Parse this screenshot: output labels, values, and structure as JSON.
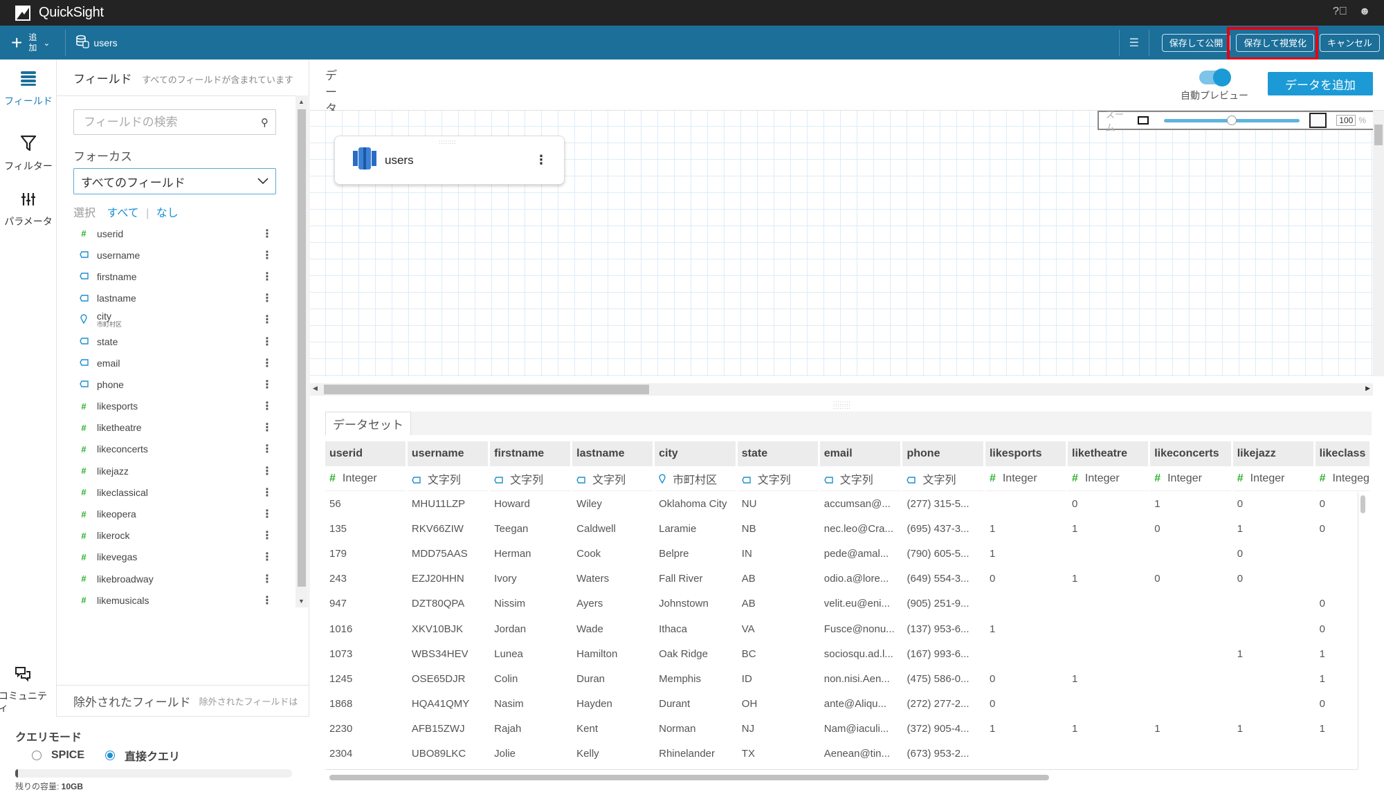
{
  "app": {
    "title": "QuickSight"
  },
  "topbar": {
    "help_icon": "help-icon",
    "user_icon": "user-icon"
  },
  "toolbar": {
    "add_label": "追加",
    "dataset_name": "users",
    "save_publish": "保存して公開",
    "save_visualize": "保存して視覚化",
    "cancel": "キャンセル"
  },
  "rail": {
    "items": [
      {
        "label": "フィールド",
        "icon": "fields-icon",
        "active": true
      },
      {
        "label": "フィルター",
        "icon": "filter-icon",
        "active": false
      },
      {
        "label": "パラメータ",
        "icon": "parameters-icon",
        "active": false
      },
      {
        "label": "コミュニティ",
        "icon": "community-icon",
        "active": false
      }
    ]
  },
  "fieldpanel": {
    "title": "フィールド",
    "subtitle": "すべてのフィールドが含まれています",
    "search_placeholder": "フィールドの検索",
    "focus_label": "フォーカス",
    "focus_value": "すべてのフィールド",
    "select_label": "選択",
    "select_all": "すべて",
    "select_none": "なし",
    "fields": [
      {
        "name": "userid",
        "type": "number",
        "sub": ""
      },
      {
        "name": "username",
        "type": "string",
        "sub": ""
      },
      {
        "name": "firstname",
        "type": "string",
        "sub": ""
      },
      {
        "name": "lastname",
        "type": "string",
        "sub": ""
      },
      {
        "name": "city",
        "type": "geo",
        "sub": "市町村区"
      },
      {
        "name": "state",
        "type": "string",
        "sub": ""
      },
      {
        "name": "email",
        "type": "string",
        "sub": ""
      },
      {
        "name": "phone",
        "type": "string",
        "sub": ""
      },
      {
        "name": "likesports",
        "type": "number",
        "sub": ""
      },
      {
        "name": "liketheatre",
        "type": "number",
        "sub": ""
      },
      {
        "name": "likeconcerts",
        "type": "number",
        "sub": ""
      },
      {
        "name": "likejazz",
        "type": "number",
        "sub": ""
      },
      {
        "name": "likeclassical",
        "type": "number",
        "sub": ""
      },
      {
        "name": "likeopera",
        "type": "number",
        "sub": ""
      },
      {
        "name": "likerock",
        "type": "number",
        "sub": ""
      },
      {
        "name": "likevegas",
        "type": "number",
        "sub": ""
      },
      {
        "name": "likebroadway",
        "type": "number",
        "sub": ""
      },
      {
        "name": "likemusicals",
        "type": "number",
        "sub": ""
      }
    ],
    "excluded_title": "除外されたフィールド",
    "excluded_sub": "除外されたフィールドは"
  },
  "querymode": {
    "title": "クエリモード",
    "options": [
      {
        "label": "SPICE",
        "selected": false
      },
      {
        "label": "直接クエリ",
        "selected": true
      }
    ],
    "capacity_used_fraction": 0.01,
    "capacity_label": "残りの容量: ",
    "capacity_value": "10GB"
  },
  "canvas": {
    "title": "データ",
    "auto_preview_label": "自動プレビュー",
    "auto_preview_on": true,
    "add_data_label": "データを追加",
    "zoom_label": "ズーム",
    "zoom_percent": "100",
    "zoom_percent_sign": "%",
    "zoom_slider_fraction": 0.5,
    "node": {
      "name": "users"
    }
  },
  "dataset": {
    "tab_label": "データセット",
    "columns": [
      {
        "name": "userid",
        "type": "Integer",
        "kind": "number"
      },
      {
        "name": "username",
        "type": "文字列",
        "kind": "string"
      },
      {
        "name": "firstname",
        "type": "文字列",
        "kind": "string"
      },
      {
        "name": "lastname",
        "type": "文字列",
        "kind": "string"
      },
      {
        "name": "city",
        "type": "市町村区",
        "kind": "geo"
      },
      {
        "name": "state",
        "type": "文字列",
        "kind": "string"
      },
      {
        "name": "email",
        "type": "文字列",
        "kind": "string"
      },
      {
        "name": "phone",
        "type": "文字列",
        "kind": "string"
      },
      {
        "name": "likesports",
        "type": "Integer",
        "kind": "number"
      },
      {
        "name": "liketheatre",
        "type": "Integer",
        "kind": "number"
      },
      {
        "name": "likeconcerts",
        "type": "Integer",
        "kind": "number"
      },
      {
        "name": "likejazz",
        "type": "Integer",
        "kind": "number"
      },
      {
        "name": "likeclass",
        "type": "Integeg",
        "kind": "number"
      }
    ],
    "rows": [
      [
        "56",
        "MHU11LZP",
        "Howard",
        "Wiley",
        "Oklahoma City",
        "NU",
        "accumsan@...",
        "(277) 315-5...",
        "",
        "0",
        "1",
        "0",
        "0"
      ],
      [
        "135",
        "RKV66ZIW",
        "Teegan",
        "Caldwell",
        "Laramie",
        "NB",
        "nec.leo@Cra...",
        "(695) 437-3...",
        "1",
        "1",
        "0",
        "1",
        "0"
      ],
      [
        "179",
        "MDD75AAS",
        "Herman",
        "Cook",
        "Belpre",
        "IN",
        "pede@amal...",
        "(790) 605-5...",
        "1",
        "",
        "",
        "0",
        ""
      ],
      [
        "243",
        "EZJ20HHN",
        "Ivory",
        "Waters",
        "Fall River",
        "AB",
        "odio.a@lore...",
        "(649) 554-3...",
        "0",
        "1",
        "0",
        "0",
        ""
      ],
      [
        "947",
        "DZT80QPA",
        "Nissim",
        "Ayers",
        "Johnstown",
        "AB",
        "velit.eu@eni...",
        "(905) 251-9...",
        "",
        "",
        "",
        "",
        "0"
      ],
      [
        "1016",
        "XKV10BJK",
        "Jordan",
        "Wade",
        "Ithaca",
        "VA",
        "Fusce@nonu...",
        "(137) 953-6...",
        "1",
        "",
        "",
        "",
        "0"
      ],
      [
        "1073",
        "WBS34HEV",
        "Lunea",
        "Hamilton",
        "Oak Ridge",
        "BC",
        "sociosqu.ad.l...",
        "(167) 993-6...",
        "",
        "",
        "",
        "1",
        "1"
      ],
      [
        "1245",
        "OSE65DJR",
        "Colin",
        "Duran",
        "Memphis",
        "ID",
        "non.nisi.Aen...",
        "(475) 586-0...",
        "0",
        "1",
        "",
        "",
        "1"
      ],
      [
        "1868",
        "HQA41QMY",
        "Nasim",
        "Hayden",
        "Durant",
        "OH",
        "ante@Aliqu...",
        "(272) 277-2...",
        "0",
        "",
        "",
        "",
        "0"
      ],
      [
        "2230",
        "AFB15ZWJ",
        "Rajah",
        "Kent",
        "Norman",
        "NJ",
        "Nam@iaculi...",
        "(372) 905-4...",
        "1",
        "1",
        "1",
        "1",
        "1"
      ],
      [
        "2304",
        "UBO89LKC",
        "Jolie",
        "Kelly",
        "Rhinelander",
        "TX",
        "Aenean@tin...",
        "(673) 953-2...",
        "",
        "",
        "",
        "",
        ""
      ]
    ]
  }
}
